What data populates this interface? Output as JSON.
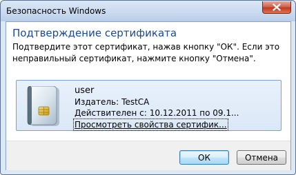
{
  "window": {
    "title": "Безопасность Windows"
  },
  "dialog": {
    "heading": "Подтверждение сертификата",
    "instruction_line1": "Подтвердите этот сертификат, нажав кнопку \"ОК\". Если это",
    "instruction_line2": "неправильный сертификат, нажмите кнопку \"Отмена\"."
  },
  "certificate": {
    "icon": "smart-card-certificate-icon",
    "subject": "user",
    "issuer_label": "Издатель:",
    "issuer_value": "TestCA",
    "validity_label": "Действителен с:",
    "validity_value": "10.12.2011 по 09.1...",
    "properties_link": "Просмотреть свойства сертифик..."
  },
  "buttons": {
    "ok": "ОК",
    "cancel": "Отмена"
  },
  "colors": {
    "heading": "#1a4a8f",
    "cert_box_border": "#7da2ce",
    "close_button": "#c1391f",
    "default_button_border": "#3c7fb1"
  }
}
